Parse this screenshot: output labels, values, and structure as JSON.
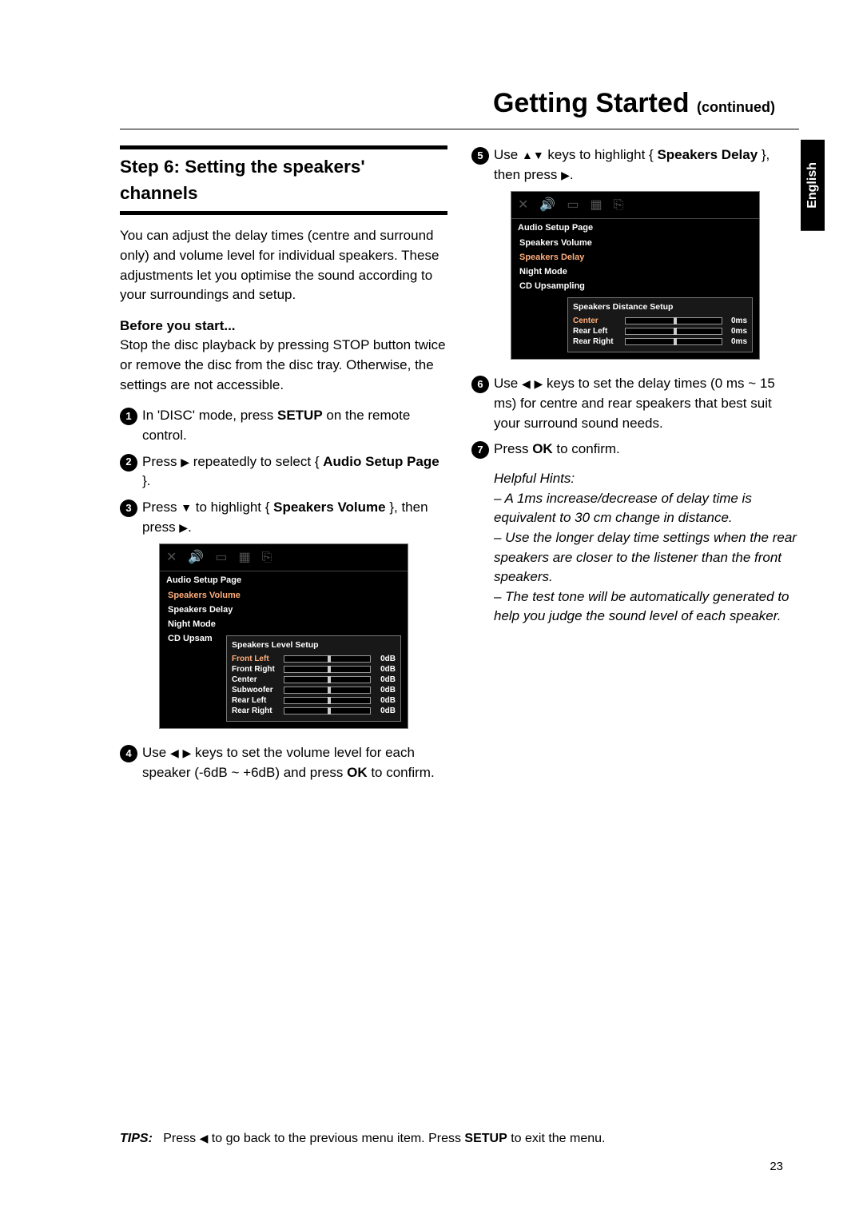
{
  "heading": {
    "main": "Getting Started",
    "cont": "(continued)"
  },
  "language_tab": "English",
  "left": {
    "section_title": "Step 6: Setting the speakers' channels",
    "intro": "You can adjust the delay times (centre and surround only) and volume level for individual speakers. These adjustments let you optimise the sound according to your surroundings and setup.",
    "before_label": "Before you start...",
    "before_text": "Stop the disc playback by pressing STOP button twice or remove the disc from the disc tray. Otherwise, the settings are not accessible.",
    "s1_a": "In 'DISC' mode, press ",
    "s1_b": "SETUP",
    "s1_c": " on the remote control.",
    "s2_a": "Press ",
    "s2_b": " repeatedly to select { ",
    "s2_c": "Audio Setup Page",
    "s2_d": " }.",
    "s3_a": "Press ",
    "s3_b": " to highlight { ",
    "s3_c": "Speakers Volume",
    "s3_d": " }, then press ",
    "s4_a": "Use ",
    "s4_b": " keys to set the volume level for each speaker (-6dB ~ +6dB) and press ",
    "s4_c": "OK",
    "s4_d": " to confirm."
  },
  "right": {
    "s5_a": "Use ",
    "s5_b": " keys to highlight { ",
    "s5_c": "Speakers Delay",
    "s5_d": " }, then press ",
    "s6_a": "Use ",
    "s6_b": " keys to set the delay times (0 ms ~ 15 ms) for centre and rear speakers that best suit your surround sound needs.",
    "s7_a": "Press ",
    "s7_b": "OK",
    "s7_c": " to confirm.",
    "hints_label": "Helpful Hints:",
    "hint1": "– A 1ms increase/decrease of delay time is equivalent to 30 cm change in distance.",
    "hint2": "– Use the longer delay time settings when the rear speakers are closer to the listener than the front speakers.",
    "hint3": "– The test tone will be automatically generated to help you judge the sound level of each speaker."
  },
  "osd1": {
    "title": "Audio Setup Page",
    "items": [
      "Speakers Volume",
      "Speakers Delay",
      "Night Mode",
      "CD Upsam"
    ],
    "panel_title": "Speakers Level Setup",
    "rows": [
      {
        "name": "Front Left",
        "val": "0dB"
      },
      {
        "name": "Front Right",
        "val": "0dB"
      },
      {
        "name": "Center",
        "val": "0dB"
      },
      {
        "name": "Subwoofer",
        "val": "0dB"
      },
      {
        "name": "Rear Left",
        "val": "0dB"
      },
      {
        "name": "Rear Right",
        "val": "0dB"
      }
    ]
  },
  "osd2": {
    "title": "Audio Setup Page",
    "items": [
      "Speakers Volume",
      "Speakers Delay",
      "Night Mode",
      "CD Upsampling"
    ],
    "panel_title": "Speakers Distance Setup",
    "rows": [
      {
        "name": "Center",
        "val": "0ms"
      },
      {
        "name": "Rear Left",
        "val": "0ms"
      },
      {
        "name": "Rear Right",
        "val": "0ms"
      }
    ]
  },
  "footer": {
    "tips_label": "TIPS:",
    "a": "Press ",
    "b": " to go back to the previous menu item. Press ",
    "c": "SETUP",
    "d": " to exit the menu."
  },
  "page_number": "23"
}
